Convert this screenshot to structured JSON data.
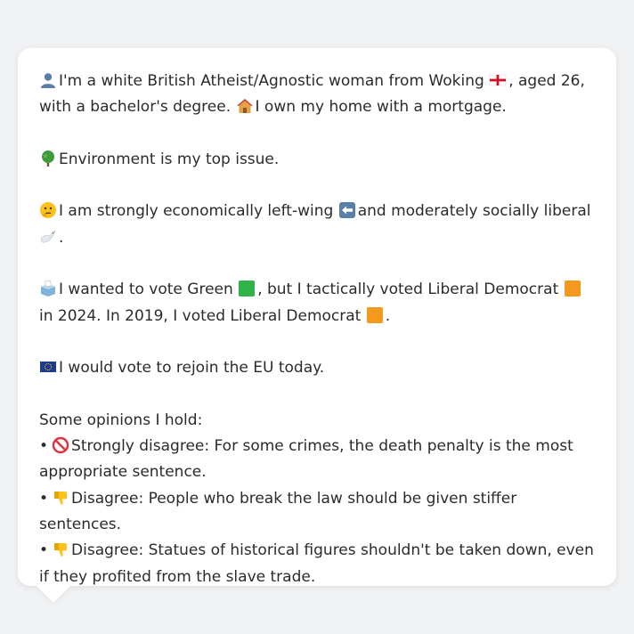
{
  "profile": {
    "line1_part1": "I'm a white British Atheist/Agnostic woman from Woking",
    "line1_part2": ", aged 26, with a bachelor's degree.",
    "line1_part3": "I own my home with a mortgage.",
    "issue": "Environment is my top issue.",
    "politics_part1": "I am strongly economically left-wing",
    "politics_part2": "and moderately socially liberal",
    "politics_part3": ".",
    "vote_part1": "I wanted to vote Green",
    "vote_part2": ", but I tactically voted Liberal Democrat",
    "vote_part3": "in 2024. In 2019, I voted Liberal Democrat",
    "vote_part4": ".",
    "eu": "I would vote to rejoin the EU today."
  },
  "opinions": {
    "heading": "Some opinions I hold:",
    "items": [
      {
        "bullet": "•",
        "icon": "no-entry-icon",
        "text": "Strongly disagree: For some crimes, the death penalty is the most appropriate sentence."
      },
      {
        "bullet": "•",
        "icon": "thumbs-down-icon",
        "text": "Disagree: People who break the law should be given stiffer sentences."
      },
      {
        "bullet": "•",
        "icon": "thumbs-down-icon",
        "text": "Disagree: Statues of historical figures shouldn't be taken down, even if they profited from the slave trade."
      }
    ]
  },
  "colors": {
    "green_party": "#2fb34a",
    "libdem": "#f39a1e",
    "eu_blue": "#1f3a93",
    "no_entry": "#e0323a"
  }
}
